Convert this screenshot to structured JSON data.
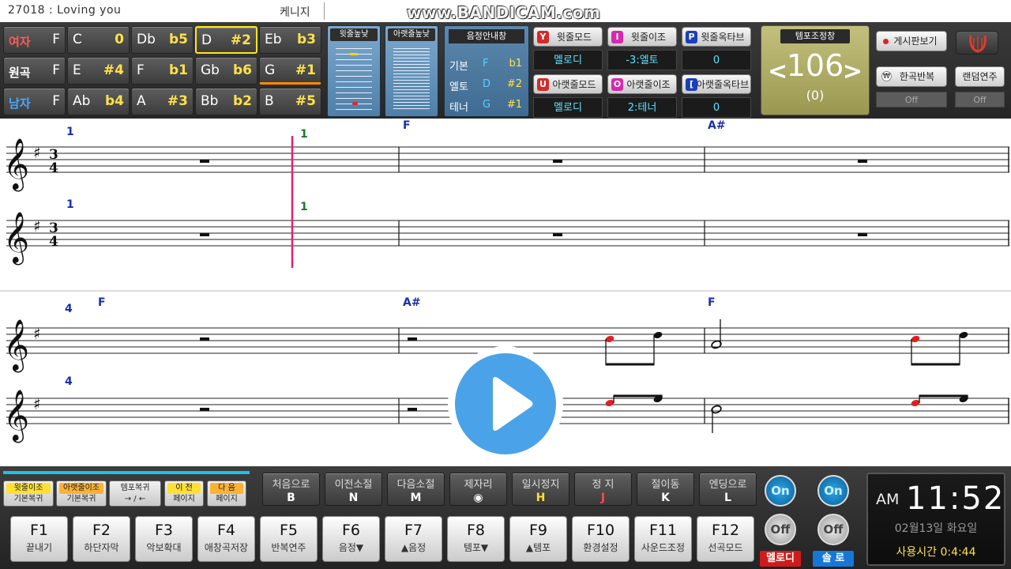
{
  "titlebar": {
    "song": "27018 : Loving you",
    "artist": "케니지",
    "watermark": "www.BANDICAM.com"
  },
  "key_grid": {
    "rows": [
      {
        "label": "여자",
        "label_acc": "F",
        "cells": [
          {
            "n": "C",
            "a": "0"
          },
          {
            "n": "Db",
            "a": "b5"
          },
          {
            "n": "D",
            "a": "#2"
          },
          {
            "n": "Eb",
            "a": "b3"
          }
        ]
      },
      {
        "label": "원곡",
        "label_acc": "F",
        "cells": [
          {
            "n": "E",
            "a": "#4"
          },
          {
            "n": "F",
            "a": "b1"
          },
          {
            "n": "Gb",
            "a": "b6"
          },
          {
            "n": "G",
            "a": "#1"
          }
        ]
      },
      {
        "label": "남자",
        "label_acc": "F",
        "cells": [
          {
            "n": "Ab",
            "a": "b4"
          },
          {
            "n": "A",
            "a": "#3"
          },
          {
            "n": "Bb",
            "a": "b2"
          },
          {
            "n": "B",
            "a": "#5"
          }
        ]
      }
    ],
    "selected_yellow": "D",
    "selected_orange": "G"
  },
  "scopes": {
    "upper": {
      "title": "윗줄높낮"
    },
    "lower": {
      "title": "아랫줄높낮"
    }
  },
  "guide": {
    "title": "음정안내창",
    "rows": [
      {
        "label": "기본",
        "note": "F",
        "acc": "b1"
      },
      {
        "label": "엘토",
        "note": "D",
        "acc": "#2"
      },
      {
        "label": "테너",
        "note": "G",
        "acc": "#1"
      }
    ]
  },
  "mode_buttons": [
    {
      "tag": "Y",
      "tag_color": "#d42a2a",
      "label": "윗줄모드",
      "value": "멜로디"
    },
    {
      "tag": "I",
      "tag_color": "#d42ab0",
      "label": "윗줄이조",
      "value": "-3:엘토"
    },
    {
      "tag": "P",
      "tag_color": "#1a3fb8",
      "label": "윗줄옥타브",
      "value": "0"
    },
    {
      "tag": "U",
      "tag_color": "#d42a2a",
      "label": "아랫줄모드",
      "value": "멜로디"
    },
    {
      "tag": "O",
      "tag_color": "#d42ab0",
      "label": "아랫줄이조",
      "value": "2:테너"
    },
    {
      "tag": "[",
      "tag_color": "#1a3fb8",
      "label": "아랫줄옥타브",
      "value": "0"
    }
  ],
  "tempo": {
    "title": "템포조정창",
    "value": "106",
    "delta": "(0)",
    "left_arrow": "<",
    "right_arrow": ">"
  },
  "right_buttons": {
    "board": "게시판보기",
    "repeat": "한곡반복",
    "repeat_state": "Off",
    "random": "랜덤연주",
    "random_state": "Off"
  },
  "score": {
    "systems": [
      {
        "upper": {
          "measure_num": "1",
          "time_sig": [
            "3",
            "4"
          ],
          "chords": [
            {
              "text": "1",
              "type": "number"
            },
            {
              "text": "F"
            },
            {
              "text": "A#"
            }
          ]
        },
        "lower": {
          "measure_num": "1",
          "time_sig": [
            "3",
            "4"
          ],
          "chords": [
            {
              "text": "1",
              "type": "number"
            }
          ]
        }
      },
      {
        "upper": {
          "measure_num": "4",
          "chords": [
            {
              "text": "F"
            },
            {
              "text": "A#"
            },
            {
              "text": "F"
            }
          ]
        },
        "lower": {
          "measure_num": "4"
        }
      }
    ]
  },
  "bottom": {
    "progress_fraction": 0.25,
    "yellow_buttons": [
      {
        "top": "윗줄이조",
        "bottom": "기본복귀",
        "style": "y"
      },
      {
        "top": "아랫줄이조",
        "bottom": "기본복귀",
        "style": "o"
      },
      {
        "top": "템포복귀",
        "bottom": "→ / ←",
        "style": "w"
      },
      {
        "top": "이  전",
        "bottom": "페이지",
        "style": "y"
      },
      {
        "top": "다  음",
        "bottom": "페이지",
        "style": "o"
      }
    ],
    "nav_buttons": [
      {
        "label": "처음으로",
        "key": "B",
        "key_color": "#fff"
      },
      {
        "label": "이전소절",
        "key": "N",
        "key_color": "#fff"
      },
      {
        "label": "다음소절",
        "key": "M",
        "key_color": "#fff"
      },
      {
        "label": "제자리",
        "key": "◉",
        "key_color": "#fff"
      },
      {
        "label": "일시정지",
        "key": "H",
        "key_color": "#ffe033"
      },
      {
        "label": "정  지",
        "key": "J",
        "key_color": "#ff4a4a"
      },
      {
        "label": "절이동",
        "key": "K",
        "key_color": "#fff"
      },
      {
        "label": "엔딩으로",
        "key": "L",
        "key_color": "#fff"
      }
    ],
    "f_buttons": [
      {
        "key": "F1",
        "label": "끝내기"
      },
      {
        "key": "F2",
        "label": "하단자막"
      },
      {
        "key": "F3",
        "label": "악보확대"
      },
      {
        "key": "F4",
        "label": "애창곡저장"
      },
      {
        "key": "F5",
        "label": "반복연주"
      },
      {
        "key": "F6",
        "label": "음정▼"
      },
      {
        "key": "F7",
        "label": "▲음정"
      },
      {
        "key": "F8",
        "label": "템포▼"
      },
      {
        "key": "F9",
        "label": "▲템포"
      },
      {
        "key": "F10",
        "label": "환경설정"
      },
      {
        "key": "F11",
        "label": "사운드조정"
      },
      {
        "key": "F12",
        "label": "선곡모드"
      }
    ],
    "toggles": [
      {
        "on": "On",
        "off": "Off",
        "label": "멜로디",
        "label_color": "#e02020"
      },
      {
        "on": "On",
        "off": "Off",
        "label": "솔  로",
        "label_color": "#1677d8"
      }
    ],
    "clock": {
      "ampm": "AM",
      "time": "11:52",
      "date": "02월13일 화요일",
      "used": "사용시간 0:4:44"
    }
  },
  "icons": {
    "play": "play-icon",
    "logo": "app-logo-icon"
  },
  "colors": {
    "chord_blue": "#1a2fa8",
    "measure_green": "#1a7a2a",
    "playhead": "#e0207a",
    "note_red": "#e02020"
  }
}
